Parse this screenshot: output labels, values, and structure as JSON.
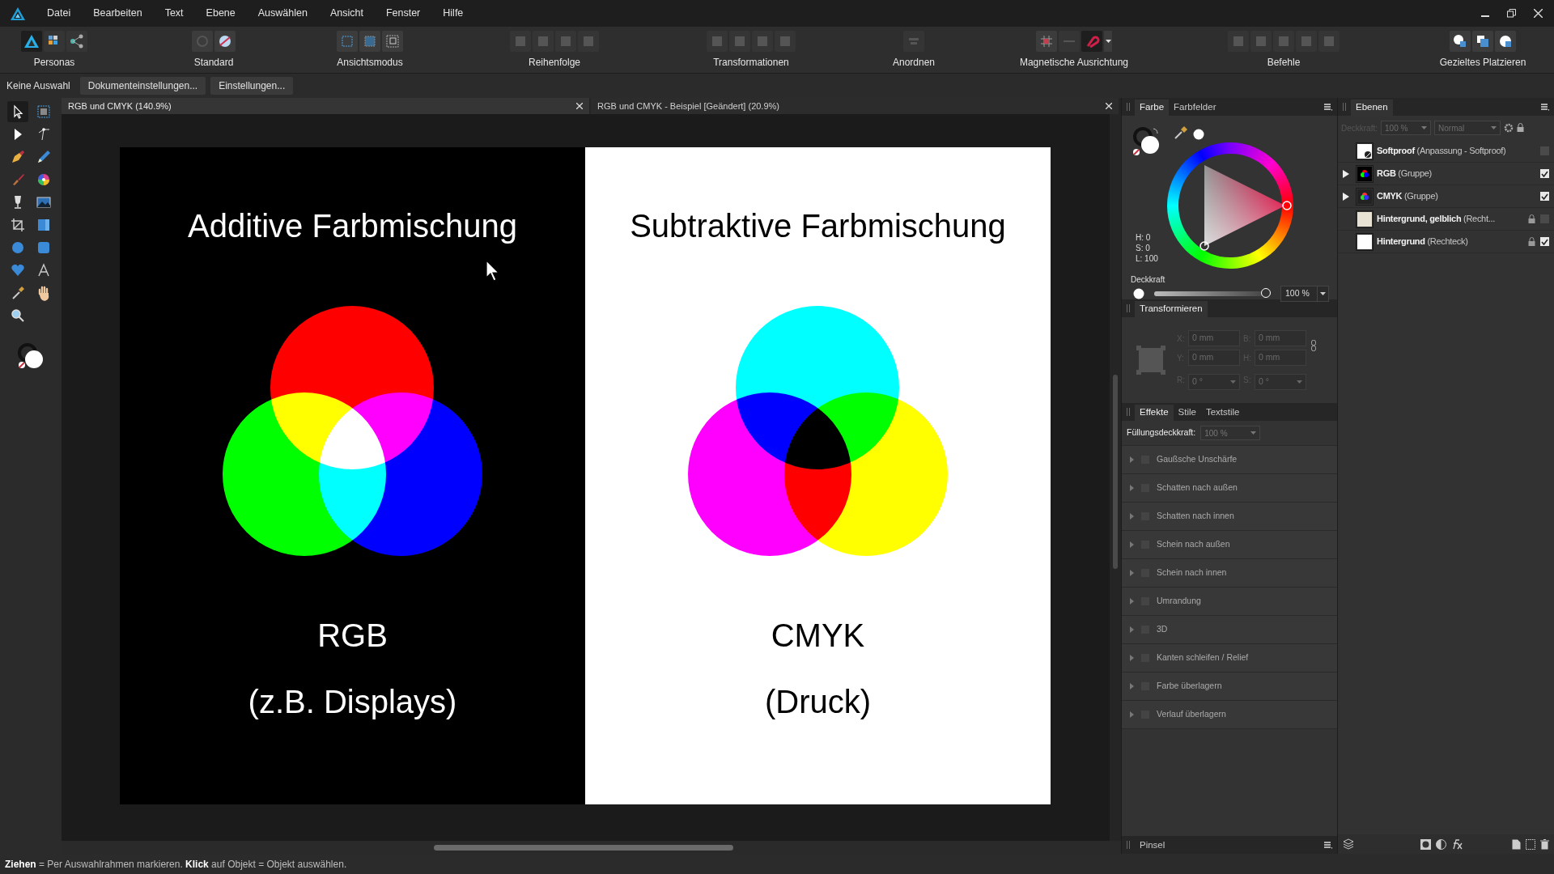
{
  "menu": [
    "Datei",
    "Bearbeiten",
    "Text",
    "Ebene",
    "Auswählen",
    "Ansicht",
    "Fenster",
    "Hilfe"
  ],
  "toolbar": [
    {
      "kind": "personas",
      "label": "Personas"
    },
    {
      "kind": "standard",
      "label": "Standard"
    },
    {
      "kind": "view_mode",
      "label": "Ansichtsmodus"
    },
    {
      "kind": "order",
      "label": "Reihenfolge"
    },
    {
      "kind": "transform",
      "label": "Transformationen"
    },
    {
      "kind": "arrange",
      "label": "Anordnen"
    },
    {
      "kind": "snapping",
      "label": "Magnetische Ausrichtung"
    },
    {
      "kind": "commands",
      "label": "Befehle"
    },
    {
      "kind": "placement",
      "label": "Gezieltes Platzieren"
    }
  ],
  "context_bar": {
    "label": "Keine Auswahl",
    "buttons": [
      "Dokumenteinstellungen...",
      "Einstellungen..."
    ]
  },
  "tools": [
    {
      "kind": "move",
      "selected": true
    },
    {
      "kind": "artboard",
      "selected": false
    },
    {
      "kind": "node",
      "selected": false
    },
    {
      "kind": "corner",
      "selected": false
    },
    {
      "kind": "pen",
      "selected": false
    },
    {
      "kind": "pencil",
      "selected": false
    },
    {
      "kind": "brush",
      "selected": false
    },
    {
      "kind": "fill",
      "selected": false
    },
    {
      "kind": "transparency",
      "selected": false
    },
    {
      "kind": "image",
      "selected": false
    },
    {
      "kind": "crop",
      "selected": false
    },
    {
      "kind": "gradient_rect",
      "selected": false
    },
    {
      "kind": "ellipse",
      "selected": false
    },
    {
      "kind": "rounded_rect",
      "selected": false
    },
    {
      "kind": "heart",
      "selected": false
    },
    {
      "kind": "text",
      "selected": false
    },
    {
      "kind": "picker",
      "selected": false
    },
    {
      "kind": "hand",
      "selected": false
    },
    {
      "kind": "zoom",
      "selected": false
    }
  ],
  "document_tabs": [
    {
      "title": "RGB und CMYK (140.9%)",
      "selected": true
    },
    {
      "title": "RGB und CMYK - Beispiel [Geändert] (20.9%)",
      "selected": false
    }
  ],
  "artboard": [
    {
      "kind": "additive",
      "title": "Additive Farbmischung",
      "label": "RGB",
      "caption": "(z.B. Displays)"
    },
    {
      "kind": "subtractive",
      "title": "Subtraktive Farbmischung",
      "label": "CMYK",
      "caption": "(Druck)"
    }
  ],
  "color_panel": {
    "tabs": [
      {
        "label": "Farbe",
        "selected": true
      },
      {
        "label": "Farbfelder",
        "selected": false
      }
    ],
    "hsl": [
      "H: 0",
      "S: 0",
      "L: 100"
    ],
    "opacity": {
      "label": "Deckkraft",
      "level": 1,
      "value": "100 %"
    }
  },
  "transform_panel": {
    "title": "Transformieren",
    "fields": [
      {
        "label": "X:",
        "value": "0 mm",
        "kind": "number",
        "disabled": true
      },
      {
        "label": "B:",
        "value": "0 mm",
        "kind": "number",
        "disabled": true
      },
      {
        "label": "Y:",
        "value": "0 mm",
        "kind": "number",
        "disabled": true
      },
      {
        "label": "H:",
        "value": "0 mm",
        "kind": "number",
        "disabled": true
      },
      {
        "label": "R:",
        "value": "0 °",
        "kind": "dropdown",
        "disabled": true
      },
      {
        "label": "S:",
        "value": "0 °",
        "kind": "dropdown",
        "disabled": true
      }
    ]
  },
  "effects_panel": {
    "tabs": [
      {
        "label": "Effekte",
        "selected": true
      },
      {
        "label": "Stile",
        "selected": false
      },
      {
        "label": "Textstile",
        "selected": false
      }
    ],
    "fill_opacity": {
      "label": "Füllungsdeckkraft:",
      "value": "100 %",
      "disabled": true
    },
    "effects": [
      {
        "label": "Gaußsche Unschärfe",
        "checked": false
      },
      {
        "label": "Schatten nach außen",
        "checked": false
      },
      {
        "label": "Schatten nach innen",
        "checked": false
      },
      {
        "label": "Schein nach außen",
        "checked": false
      },
      {
        "label": "Schein nach innen",
        "checked": false
      },
      {
        "label": "Umrandung",
        "checked": false
      },
      {
        "label": "3D",
        "checked": false
      },
      {
        "label": "Kanten schleifen / Relief",
        "checked": false
      },
      {
        "label": "Farbe überlagern",
        "checked": false
      },
      {
        "label": "Verlauf überlagern",
        "checked": false
      }
    ]
  },
  "brush_panel": {
    "title": "Pinsel"
  },
  "layers_panel": {
    "title": "Ebenen",
    "opacity_label": "Deckkraft:",
    "opacity_value": "100 %",
    "blend_mode": "Normal",
    "disabled": true,
    "layers": [
      {
        "label": "**Softproof** (Anpassung - Softproof)",
        "kind": "adjustment",
        "expandable": false,
        "locked": false,
        "visible": false
      },
      {
        "label": "**RGB** (Gruppe)",
        "kind": "rgb",
        "expandable": true,
        "locked": false,
        "visible": true
      },
      {
        "label": "**CMYK** (Gruppe)",
        "kind": "cmyk",
        "expandable": true,
        "locked": false,
        "visible": true
      },
      {
        "label": "**Hintergrund, gelblich** (Recht...",
        "kind": "cream",
        "expandable": false,
        "locked": true,
        "visible": false
      },
      {
        "label": "**Hintergrund** (Rechteck)",
        "kind": "white",
        "expandable": false,
        "locked": true,
        "visible": true
      }
    ]
  },
  "status_bar": "**Ziehen** = Per Auswahlrahmen markieren. **Klick** auf Objekt = Objekt auswählen."
}
